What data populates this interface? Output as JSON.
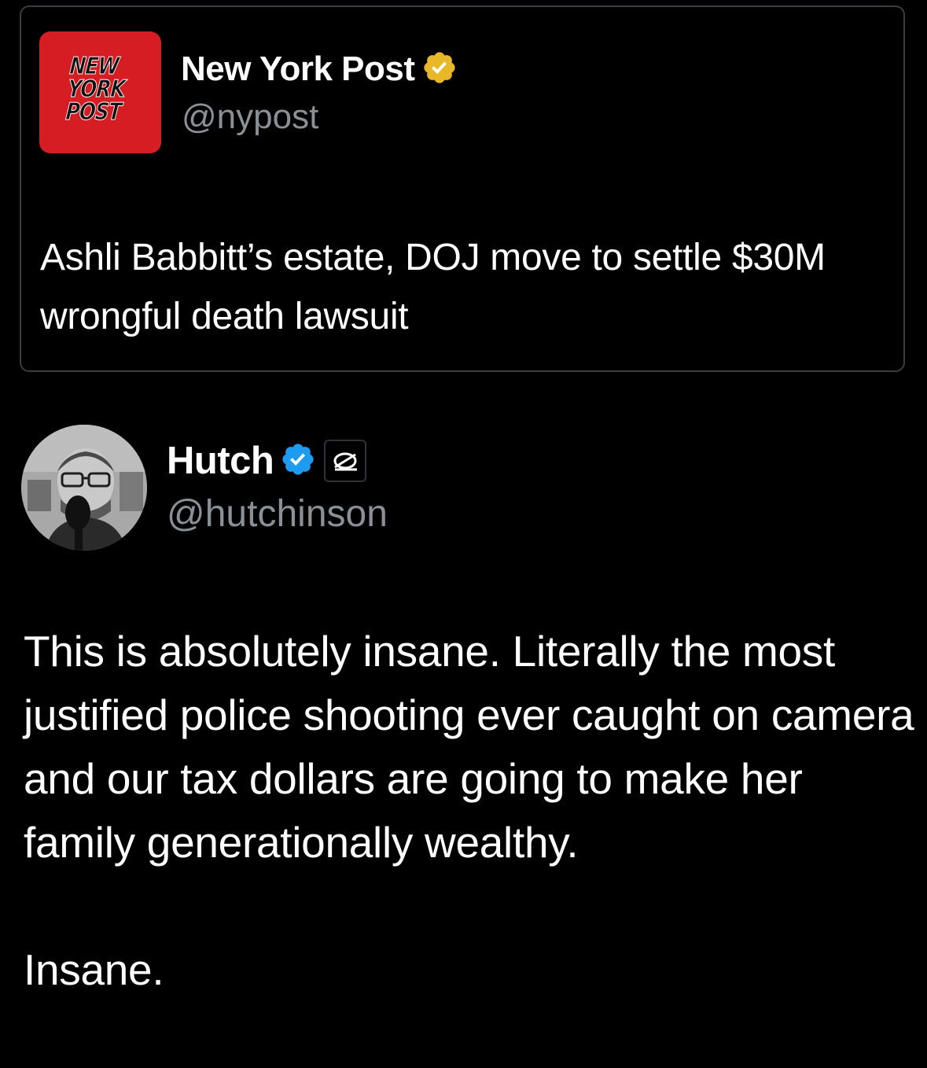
{
  "quoted_tweet": {
    "logo_text": [
      "NEW",
      "YORK",
      "POST"
    ],
    "display_name": "New York Post",
    "handle": "@nypost",
    "verified_badge": "gold-check-badge-icon",
    "text": "Ashli Babbitt’s estate, DOJ move to settle $30M wrongful death lawsuit"
  },
  "tweet": {
    "display_name": "Hutch",
    "handle": "@hutchinson",
    "verified_badge": "blue-check-badge-icon",
    "affiliate_badge": "optic-gaming-affiliate-icon",
    "paragraphs": [
      "This is absolutely insane. Literally the most justified police shooting ever caught on camera and our tax dollars are going to make her family generationally wealthy.",
      "Insane."
    ]
  },
  "colors": {
    "background": "#000000",
    "text_primary": "#ffffff",
    "text_secondary": "#8b9096",
    "card_border": "#3a3d40",
    "nypost_red": "#d61d23",
    "gold_badge": "#e8b829",
    "blue_badge": "#1d9bf0"
  }
}
